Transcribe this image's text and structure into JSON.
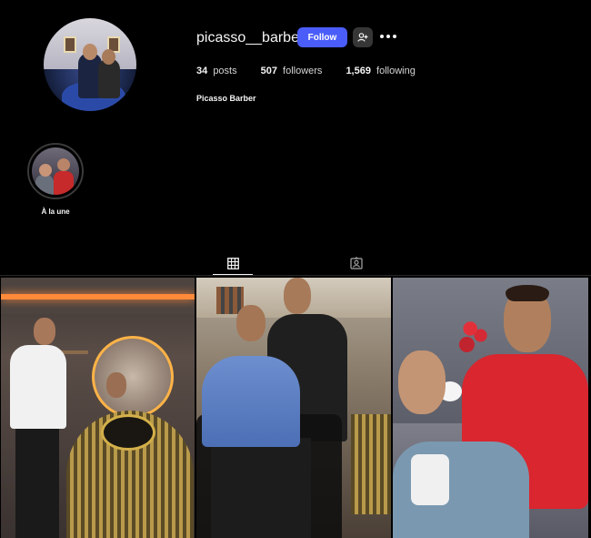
{
  "profile": {
    "username": "picasso__barber",
    "follow_label": "Follow",
    "suggest_icon": "person-add-icon",
    "more_icon": "more-horizontal-icon",
    "full_name": "Picasso Barber",
    "stats": {
      "posts_count": "34",
      "posts_label": "posts",
      "followers_count": "507",
      "followers_label": "followers",
      "following_count": "1,569",
      "following_label": "following"
    }
  },
  "highlights": [
    {
      "label": "À la une"
    }
  ],
  "tabs": [
    {
      "icon": "grid-icon",
      "active": true
    },
    {
      "icon": "tagged-icon",
      "active": false
    }
  ],
  "posts": [
    {
      "alt": ""
    },
    {
      "alt": ""
    },
    {
      "alt": ""
    }
  ],
  "colors": {
    "background": "#000000",
    "follow_button": "#4a5df9",
    "secondary_button": "#363636",
    "text": "#f5f5f5"
  }
}
